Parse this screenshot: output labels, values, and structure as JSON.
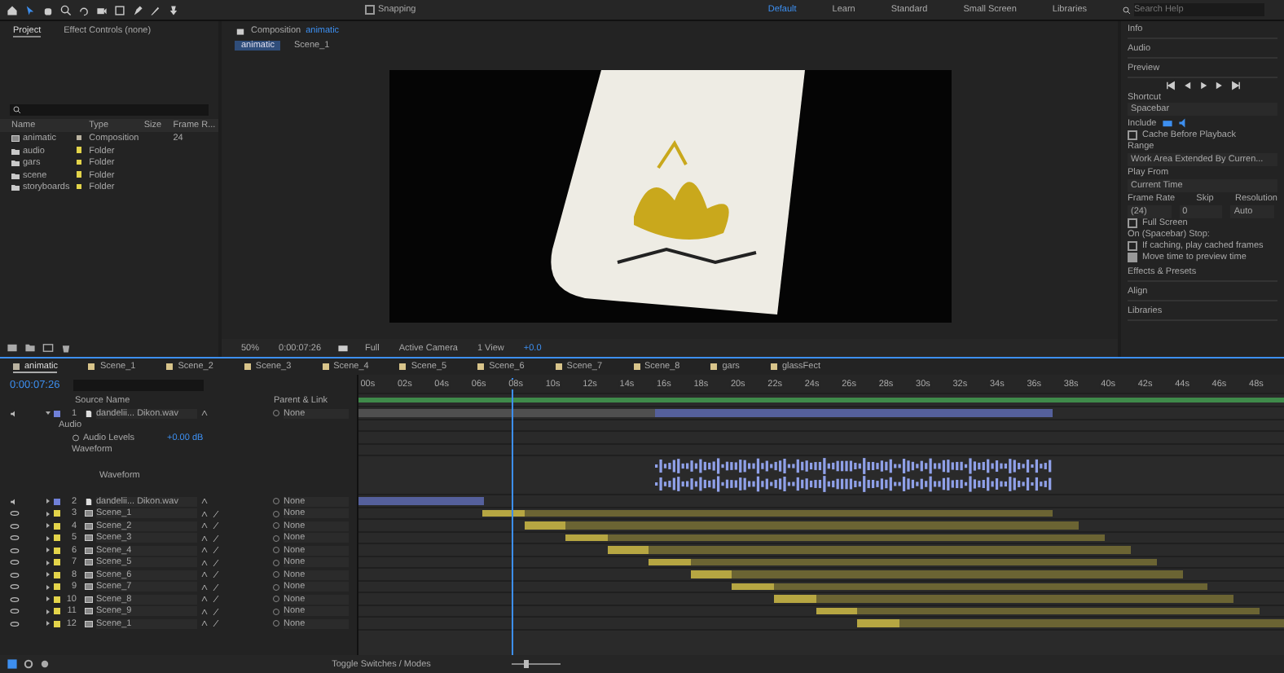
{
  "toolbar": {
    "snapping": {
      "label": "Snapping",
      "checked": false
    },
    "workspaces": [
      {
        "label": "Default",
        "selected": true
      },
      {
        "label": "Learn",
        "selected": false
      },
      {
        "label": "Standard",
        "selected": false
      },
      {
        "label": "Small Screen",
        "selected": false
      },
      {
        "label": "Libraries",
        "selected": false
      }
    ],
    "search": {
      "placeholder": "Search Help"
    }
  },
  "project": {
    "tabs": [
      {
        "label": "Project",
        "selected": true
      },
      {
        "label": "Effect Controls (none)",
        "selected": false
      }
    ],
    "columns": [
      "Name",
      "Type",
      "Size",
      "Frame R..."
    ],
    "items": [
      {
        "name": "animatic",
        "type": "Composition",
        "frame_rate": "24",
        "kind": "composition",
        "color": "#b9b2a0"
      },
      {
        "name": "audio",
        "type": "Folder",
        "kind": "folder",
        "color": "#e3d44a"
      },
      {
        "name": "gars",
        "type": "Folder",
        "kind": "folder",
        "color": "#e3d44a"
      },
      {
        "name": "scene",
        "type": "Folder",
        "kind": "folder",
        "color": "#e3d44a"
      },
      {
        "name": "storyboards",
        "type": "Folder",
        "kind": "folder",
        "color": "#e3d44a"
      }
    ]
  },
  "composition": {
    "title": "Composition",
    "name": "animatic",
    "tabs": [
      {
        "label": "animatic",
        "selected": true
      },
      {
        "label": "Scene_1",
        "selected": false
      }
    ],
    "footer": {
      "zoom": "50%",
      "timecode": "0:00:07:26",
      "resolution": "Full",
      "camera": "Active Camera",
      "views": "1 View",
      "exposure": "+0.0"
    }
  },
  "right_panel": {
    "top_sections": [
      "Info",
      "Audio"
    ],
    "preview": {
      "title": "Preview",
      "shortcut_label": "Shortcut",
      "shortcut": "Spacebar",
      "include_label": "Include",
      "cache_before_playback": {
        "label": "Cache Before Playback",
        "checked": false
      },
      "range_label": "Range",
      "range": "Work Area Extended By Curren...",
      "play_from_label": "Play From",
      "play_from": "Current Time",
      "frame_rate_label": "Frame Rate",
      "skip_label": "Skip",
      "resolution_label": "Resolution",
      "frame_rate": "(24)",
      "skip": "0",
      "resolution": "Auto",
      "full_screen": {
        "label": "Full Screen",
        "checked": false
      },
      "stop_label": "On (Spacebar) Stop:",
      "stop_options": [
        {
          "label": "If caching, play cached frames",
          "checked": false
        },
        {
          "label": "Move time to preview time",
          "checked": true
        }
      ]
    },
    "bottom_sections": [
      "Effects & Presets",
      "Align",
      "Libraries"
    ]
  },
  "timeline": {
    "tabs": [
      {
        "label": "animatic",
        "selected": true,
        "color": "#b9b2a0"
      },
      {
        "label": "Scene_1",
        "selected": false,
        "color": "#d8c48a"
      },
      {
        "label": "Scene_2",
        "selected": false,
        "color": "#d8c48a"
      },
      {
        "label": "Scene_3",
        "selected": false,
        "color": "#d8c48a"
      },
      {
        "label": "Scene_4",
        "selected": false,
        "color": "#d8c48a"
      },
      {
        "label": "Scene_5",
        "selected": false,
        "color": "#d8c48a"
      },
      {
        "label": "Scene_6",
        "selected": false,
        "color": "#d8c48a"
      },
      {
        "label": "Scene_7",
        "selected": false,
        "color": "#d8c48a"
      },
      {
        "label": "Scene_8",
        "selected": false,
        "color": "#d8c48a"
      },
      {
        "label": "gars",
        "selected": false,
        "color": "#d8c48a"
      },
      {
        "label": "glassFect",
        "selected": false,
        "color": "#d8c48a"
      }
    ],
    "timecode": "0:00:07:26",
    "columns": [
      "Source Name",
      "Parent & Link"
    ],
    "ruler": [
      "00s",
      "02s",
      "04s",
      "06s",
      "08s",
      "10s",
      "12s",
      "14s",
      "16s",
      "18s",
      "20s",
      "22s",
      "24s",
      "26s",
      "28s",
      "30s",
      "32s",
      "34s",
      "36s",
      "38s",
      "40s",
      "42s",
      "44s",
      "46s",
      "48s"
    ],
    "playhead": {
      "level": 0.165
    },
    "layers": [
      {
        "number": "1",
        "name": "dandelii... Dikon.wav",
        "kind": "audio",
        "color": "#7080d8",
        "expanded": true,
        "parent": "None",
        "audio": {
          "group": "Audio",
          "property": "Audio Levels",
          "value": "+0.00 dB",
          "waveform_group": "Waveform",
          "waveform": "Waveform"
        }
      },
      {
        "number": "2",
        "name": "dandelii... Dikon.wav",
        "kind": "audio",
        "color": "#7080d8",
        "expanded": false,
        "parent": "None"
      },
      {
        "number": "3",
        "name": "Scene_1",
        "kind": "comp",
        "color": "#e3d44a",
        "expanded": false,
        "parent": "None"
      },
      {
        "number": "4",
        "name": "Scene_2",
        "kind": "comp",
        "color": "#e3d44a",
        "expanded": false,
        "parent": "None"
      },
      {
        "number": "5",
        "name": "Scene_3",
        "kind": "comp",
        "color": "#e3d44a",
        "expanded": false,
        "parent": "None"
      },
      {
        "number": "6",
        "name": "Scene_4",
        "kind": "comp",
        "color": "#e3d44a",
        "expanded": false,
        "parent": "None"
      },
      {
        "number": "7",
        "name": "Scene_5",
        "kind": "comp",
        "color": "#e3d44a",
        "expanded": false,
        "parent": "None"
      },
      {
        "number": "8",
        "name": "Scene_6",
        "kind": "comp",
        "color": "#e3d44a",
        "expanded": false,
        "parent": "None"
      },
      {
        "number": "9",
        "name": "Scene_7",
        "kind": "comp",
        "color": "#e3d44a",
        "expanded": false,
        "parent": "None"
      },
      {
        "number": "10",
        "name": "Scene_8",
        "kind": "comp",
        "color": "#e3d44a",
        "expanded": false,
        "parent": "None"
      },
      {
        "number": "11",
        "name": "Scene_9",
        "kind": "comp",
        "color": "#e3d44a",
        "expanded": false,
        "parent": "None"
      },
      {
        "number": "12",
        "name": "Scene_1",
        "kind": "comp",
        "color": "#e3d44a",
        "expanded": false,
        "parent": "None"
      }
    ]
  },
  "status_bar": {
    "toggle": "Toggle Switches / Modes",
    "zoom_slider": {
      "level": 0.3
    }
  }
}
